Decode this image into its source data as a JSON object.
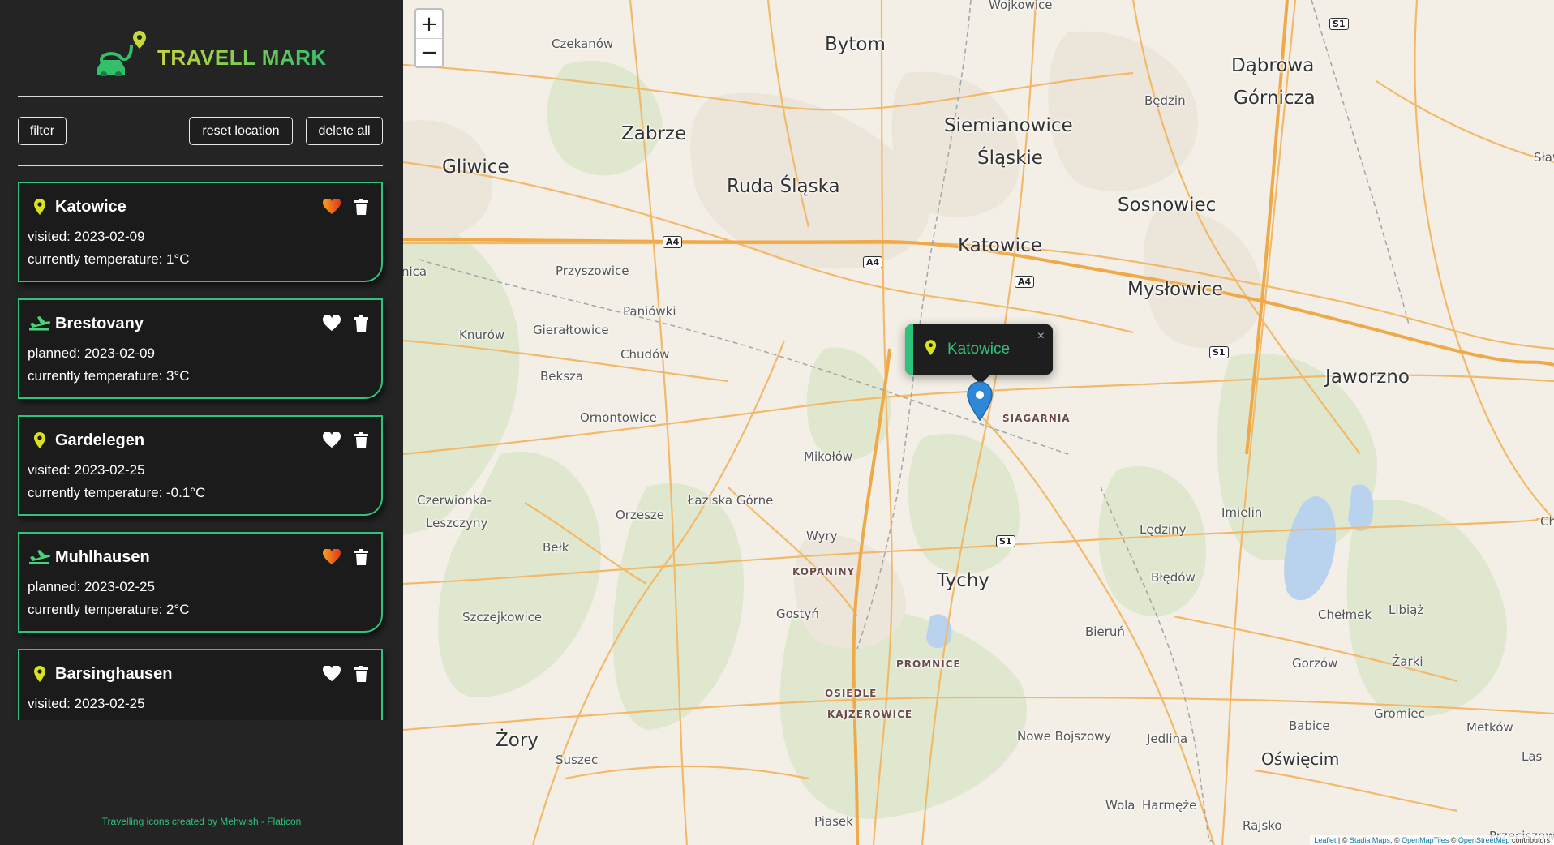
{
  "app": {
    "title": "TRAVELL MARK",
    "logo_icon": "car-route-logo-icon",
    "accent": "#2ec27a",
    "accent_yellow": "#c7d83a"
  },
  "toolbar": {
    "filter_label": "filter",
    "reset_label": "reset location",
    "delete_all_label": "delete all"
  },
  "places": [
    {
      "name": "Katowice",
      "type": "visited",
      "type_icon": "map-pin-icon",
      "date_text": "visited: 2023-02-09",
      "temp_text": "currently temperature: 1°C",
      "favorite": true
    },
    {
      "name": "Brestovany",
      "type": "planned",
      "type_icon": "plane-icon",
      "date_text": "planned: 2023-02-09",
      "temp_text": "currently temperature: 3°C",
      "favorite": false
    },
    {
      "name": "Gardelegen",
      "type": "visited",
      "type_icon": "map-pin-icon",
      "date_text": "visited: 2023-02-25",
      "temp_text": "currently temperature: -0.1°C",
      "favorite": false
    },
    {
      "name": "Muhlhausen",
      "type": "planned",
      "type_icon": "plane-icon",
      "date_text": "planned: 2023-02-25",
      "temp_text": "currently temperature: 2°C",
      "favorite": true
    },
    {
      "name": "Barsinghausen",
      "type": "visited",
      "type_icon": "map-pin-icon",
      "date_text": "visited: 2023-02-25",
      "temp_text": "",
      "favorite": false
    }
  ],
  "footer": {
    "credit": "Travelling icons created by Mehwish - Flaticon"
  },
  "map": {
    "zoom_in": "+",
    "zoom_out": "−",
    "popup": {
      "label": "Katowice",
      "close": "×"
    },
    "labels": {
      "bytom": "Bytom",
      "zabrze": "Zabrze",
      "gliwice": "Gliwice",
      "ruda": "Ruda Śląska",
      "siemianowice1": "Siemianowice",
      "siemianowice2": "Śląskie",
      "katowice": "Katowice",
      "sosnowiec": "Sosnowiec",
      "dabrowa1": "Dąbrowa",
      "dabrowa2": "Górnicza",
      "myslowice": "Mysłowice",
      "jaworzno": "Jaworzno",
      "tychy": "Tychy",
      "zory": "Żory",
      "mikolow": "Mikołów",
      "czekanow": "Czekanów",
      "bedzin": "Będzin",
      "wojkowice": "Wojkowice",
      "slawkow": "Sławk",
      "przyszowice": "Przyszowice",
      "paniowki": "Paniówki",
      "knurow": "Knurów",
      "gieraltowice": "Gierałtowice",
      "chudow": "Chudów",
      "beksza": "Beksza",
      "ornontowice": "Ornontowice",
      "czerwionka1": "Czerwionka-",
      "czerwionka2": "Leszczyny",
      "orzesze": "Orzesze",
      "laziska": "Łaziska Górne",
      "wyry": "Wyry",
      "belk": "Bełk",
      "szczejkowice": "Szczejkowice",
      "gostyn": "Gostyń",
      "kopaniny": "KOPANINY",
      "promnice": "PROMNICE",
      "osiedle1": "OSIEDLE",
      "osiedle2": "KAJZEROWICE",
      "piasek": "Piasek",
      "suszec": "Suszec",
      "siagarnia": "SIAGARNIA",
      "imielin": "Imielin",
      "ledziny": "Lędziny",
      "bledow": "Błędów",
      "bierun": "Bieruń",
      "chelmek": "Chełmek",
      "libiaz": "Libiąż",
      "gorzow": "Gorzów",
      "zarki": "Żarki",
      "gromiec": "Gromiec",
      "babice": "Babice",
      "metkow": "Metków",
      "oswiecim": "Oświęcim",
      "las": "Las",
      "nowebojszowy": "Nowe Bojszowy",
      "jedlina": "Jedlina",
      "wola": "Wola",
      "harmeze": "Harmęże",
      "rajsko": "Rajsko",
      "przeciszow": "Przeciszow",
      "chr": "Chr",
      "nica": "nica"
    },
    "roads": {
      "a4a": "A4",
      "a4b": "A4",
      "a4c": "A4",
      "s1a": "S1",
      "s1b": "S1",
      "s1c": "S1"
    },
    "attribution": {
      "leaflet": "Leaflet",
      "sep1": " | © ",
      "stadia": "Stadia Maps",
      "sep2": ", © ",
      "omt": "OpenMapTiles",
      "sep3": " © ",
      "osm": "OpenStreetMap",
      "tail": " contributors"
    }
  }
}
